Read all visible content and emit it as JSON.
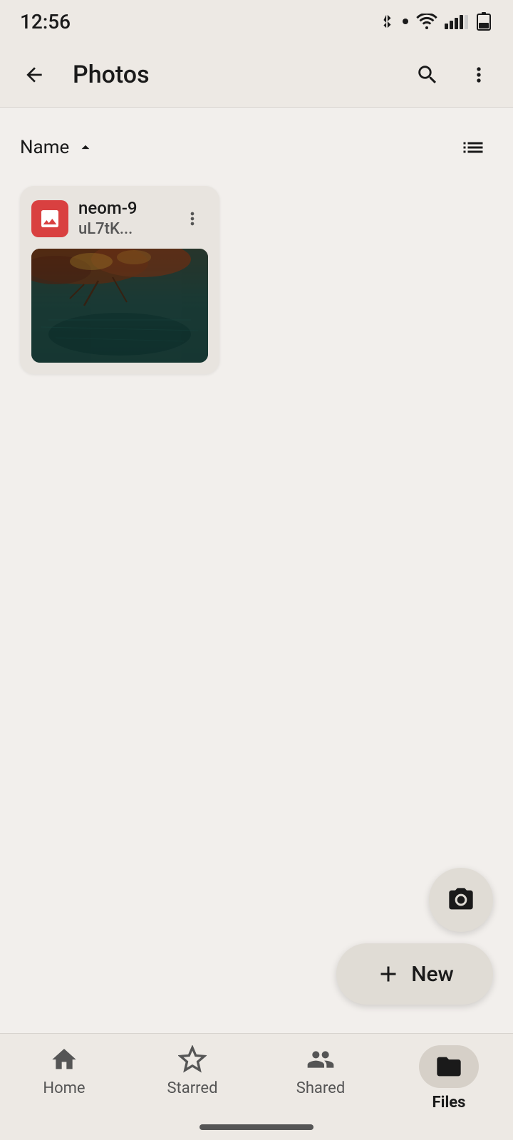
{
  "statusBar": {
    "time": "12:56"
  },
  "topBar": {
    "title": "Photos",
    "backLabel": "back",
    "searchLabel": "search",
    "moreLabel": "more options"
  },
  "sortBar": {
    "sortLabel": "Name",
    "sortDirection": "ascending",
    "listViewLabel": "list view"
  },
  "files": [
    {
      "name": "neom-9\nuL7tK...",
      "nameShort": "neom-9",
      "nameSub": "uL7tK..."
    }
  ],
  "fab": {
    "cameraLabel": "camera",
    "newLabel": "New",
    "plusLabel": "+"
  },
  "bottomNav": {
    "items": [
      {
        "id": "home",
        "label": "Home",
        "icon": "home-icon",
        "active": false
      },
      {
        "id": "starred",
        "label": "Starred",
        "icon": "star-icon",
        "active": false
      },
      {
        "id": "shared",
        "label": "Shared",
        "icon": "shared-icon",
        "active": false
      },
      {
        "id": "files",
        "label": "Files",
        "icon": "files-icon",
        "active": true
      }
    ]
  }
}
